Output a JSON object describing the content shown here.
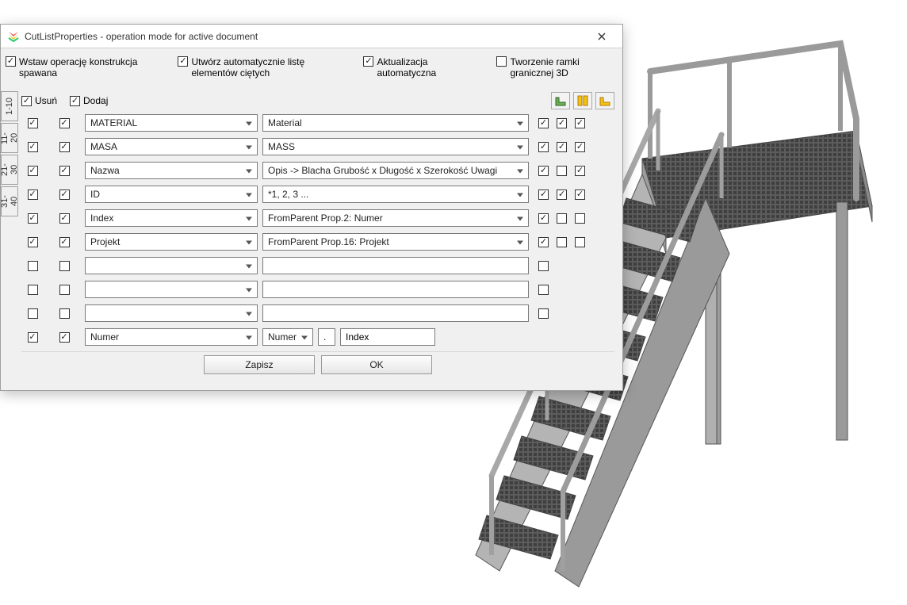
{
  "window": {
    "title": "CutListProperties - operation mode for active document"
  },
  "options": {
    "opt1": {
      "checked": true,
      "label": "Wstaw operację konstrukcja spawana"
    },
    "opt2": {
      "checked": true,
      "label": "Utwórz automatycznie listę elementów ciętych"
    },
    "opt3": {
      "checked": true,
      "label": "Aktualizacja automatyczna"
    },
    "opt4": {
      "checked": false,
      "label": "Tworzenie ramki granicznej 3D"
    }
  },
  "side_tabs": [
    "1-10",
    "11-20",
    "21-30",
    "31-40"
  ],
  "headers": {
    "remove": "Usuń",
    "add": "Dodaj"
  },
  "rows": [
    {
      "cb1": true,
      "cb2": true,
      "name": "MATERIAL",
      "value": "Material",
      "tail": [
        true,
        true,
        true
      ],
      "name_editable": true,
      "value_editable": true
    },
    {
      "cb1": true,
      "cb2": true,
      "name": "MASA",
      "value": "MASS",
      "tail": [
        true,
        true,
        true
      ],
      "name_editable": true,
      "value_editable": true
    },
    {
      "cb1": true,
      "cb2": true,
      "name": "Nazwa",
      "value": "Opis -> Blacha Grubość x Długość x Szerokość Uwagi",
      "tail": [
        true,
        false,
        true
      ],
      "name_editable": true,
      "value_editable": true
    },
    {
      "cb1": true,
      "cb2": true,
      "name": "ID",
      "value": "*1, 2, 3 ...",
      "tail": [
        true,
        true,
        true
      ],
      "name_editable": true,
      "value_editable": true
    },
    {
      "cb1": true,
      "cb2": true,
      "name": "Index",
      "value": "FromParent Prop.2: Numer",
      "tail": [
        true,
        false,
        false
      ],
      "name_editable": true,
      "value_editable": true
    },
    {
      "cb1": true,
      "cb2": true,
      "name": "Projekt",
      "value": "FromParent Prop.16: Projekt",
      "tail": [
        true,
        false,
        false
      ],
      "name_editable": true,
      "value_editable": true
    },
    {
      "cb1": false,
      "cb2": false,
      "name": "",
      "value": "",
      "tail": [
        false,
        null,
        null
      ],
      "name_editable": true,
      "value_editable": false
    },
    {
      "cb1": false,
      "cb2": false,
      "name": "",
      "value": "",
      "tail": [
        false,
        null,
        null
      ],
      "name_editable": true,
      "value_editable": false
    },
    {
      "cb1": false,
      "cb2": false,
      "name": "",
      "value": "",
      "tail": [
        false,
        null,
        null
      ],
      "name_editable": true,
      "value_editable": false
    },
    {
      "cb1": true,
      "cb2": true,
      "name": "Numer",
      "value": "",
      "tail": null,
      "name_editable": true,
      "value_editable": false,
      "is_numer": true
    }
  ],
  "numer_extra": {
    "field1": "Numer",
    "sep": ".",
    "field2": "Index"
  },
  "footer": {
    "save": "Zapisz",
    "ok": "OK"
  }
}
